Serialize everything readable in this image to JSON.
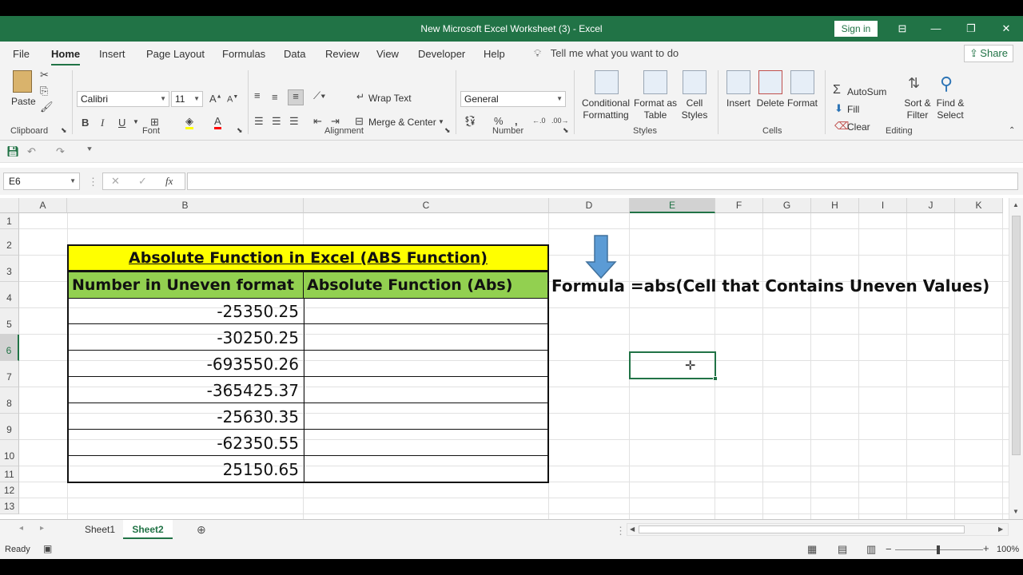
{
  "window": {
    "title": "New Microsoft Excel Worksheet (3)  -  Excel",
    "signin_label": "Sign in"
  },
  "menu": {
    "tabs": [
      "File",
      "Home",
      "Insert",
      "Page Layout",
      "Formulas",
      "Data",
      "Review",
      "View",
      "Developer",
      "Help"
    ],
    "active_tab": "Home",
    "tell_me": "Tell me what you want to do",
    "share_label": "Share"
  },
  "ribbon": {
    "clipboard": {
      "paste": "Paste",
      "label": "Clipboard"
    },
    "font": {
      "name": "Calibri",
      "size": "11",
      "bold": "B",
      "italic": "I",
      "underline": "U",
      "label": "Font"
    },
    "alignment": {
      "wrap_text": "Wrap Text",
      "merge_center": "Merge & Center",
      "label": "Alignment"
    },
    "number": {
      "format": "General",
      "percent": "%",
      "comma": ",",
      "label": "Number"
    },
    "styles": {
      "conditional_1": "Conditional",
      "conditional_2": "Formatting",
      "format_table_1": "Format as",
      "format_table_2": "Table",
      "cell_styles_1": "Cell",
      "cell_styles_2": "Styles",
      "label": "Styles"
    },
    "cells": {
      "insert": "Insert",
      "delete": "Delete",
      "format": "Format",
      "label": "Cells"
    },
    "editing": {
      "autosum": "AutoSum",
      "fill": "Fill",
      "clear": "Clear",
      "sort_1": "Sort &",
      "sort_2": "Filter",
      "find_1": "Find &",
      "find_2": "Select",
      "label": "Editing"
    }
  },
  "formula_bar": {
    "name_box": "E6",
    "fx": "fx",
    "formula": ""
  },
  "grid": {
    "columns": [
      "A",
      "B",
      "C",
      "D",
      "E",
      "F",
      "G",
      "H",
      "I",
      "J",
      "K"
    ],
    "rows": [
      "1",
      "2",
      "3",
      "4",
      "5",
      "6",
      "7",
      "8",
      "9",
      "10",
      "11",
      "12",
      "13"
    ],
    "selected_cell": "E6",
    "title": "Absolute Function in Excel (ABS Function)",
    "header_b": "Number in Uneven format",
    "header_c": "Absolute Function (Abs)",
    "values": [
      "-25350.25",
      "-30250.25",
      "-693550.26",
      "-365425.37",
      "-25630.35",
      "-62350.55",
      "25150.65"
    ],
    "formula_note": "Formula =abs(Cell that Contains Uneven Values)",
    "colors": {
      "title_fill": "#ffff00",
      "header_fill": "#92d050",
      "arrow": "#5b9bd5",
      "accent": "#217346"
    }
  },
  "sheets": {
    "tabs": [
      "Sheet1",
      "Sheet2"
    ],
    "active": "Sheet2"
  },
  "status": {
    "ready": "Ready",
    "zoom": "100%"
  }
}
